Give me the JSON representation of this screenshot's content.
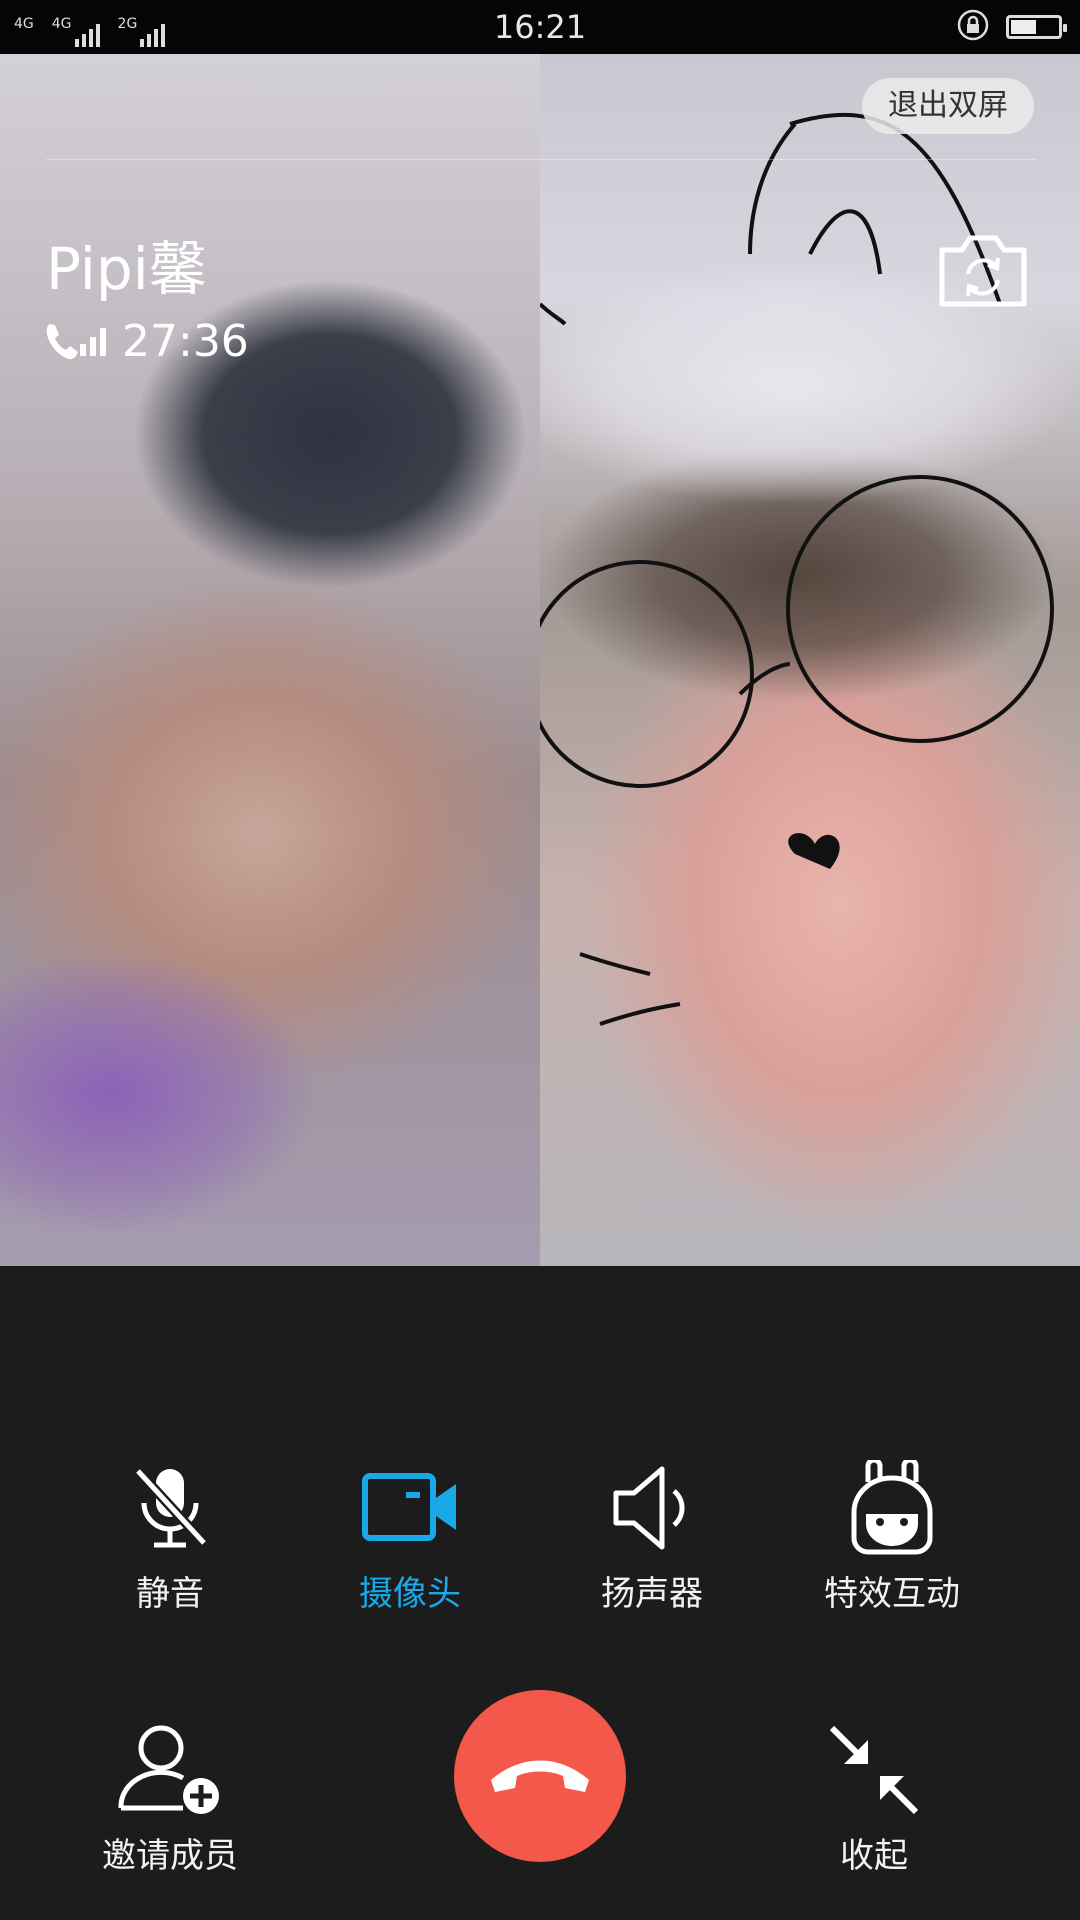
{
  "status_bar": {
    "network_1": "4G",
    "network_2": "4G",
    "network_3": "2G",
    "time": "16:21",
    "battery_level": 0.5
  },
  "call": {
    "caller_name": "Pipi馨",
    "duration": "27:36",
    "exit_dual_screen": "退出双屏"
  },
  "controls": {
    "mute": "静音",
    "camera": "摄像头",
    "speaker": "扬声器",
    "effects": "特效互动",
    "invite": "邀请成员",
    "collapse": "收起"
  },
  "colors": {
    "accent": "#19a8e8",
    "hangup": "#f4584a",
    "background": "#1c1c1c"
  },
  "icons": [
    "signal-icon",
    "rotation-lock-icon",
    "battery-icon",
    "camera-switch-icon",
    "call-signal-icon",
    "mic-off-icon",
    "video-camera-icon",
    "speaker-icon",
    "effects-icon",
    "invite-member-icon",
    "hangup-icon",
    "collapse-icon"
  ]
}
